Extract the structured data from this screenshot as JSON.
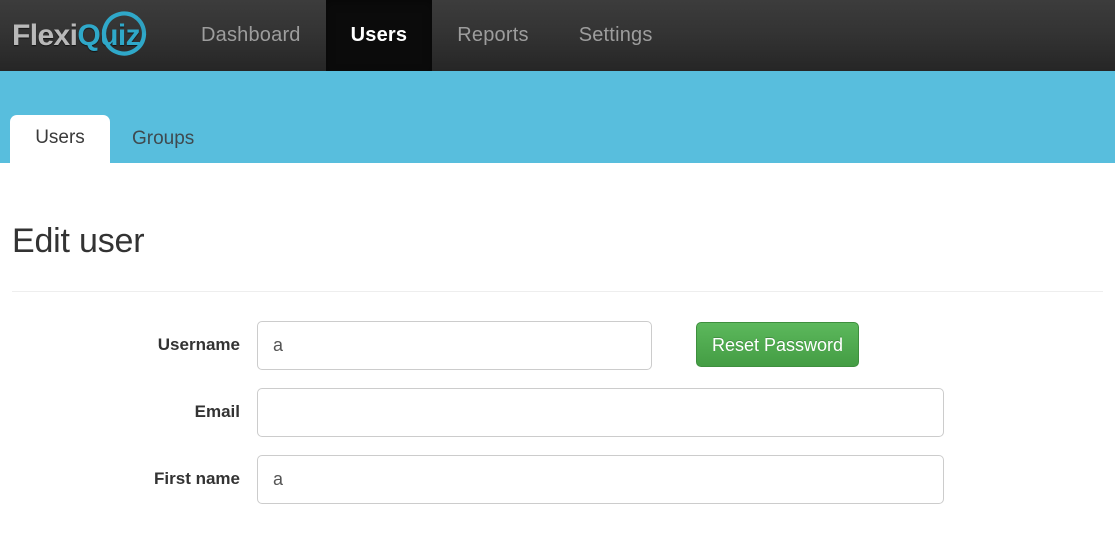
{
  "brand": {
    "name_part1": "Flexi",
    "name_part2": "Quiz",
    "ring_icon": "circular-arrow-ring-icon",
    "accent_color": "#2fa8c9",
    "text_color": "#b9b9b9"
  },
  "navbar": {
    "background_top": "#3c3c3c",
    "background_bottom": "#262626",
    "active_background": "#0b0b0b",
    "items": [
      {
        "label": "Dashboard",
        "active": false
      },
      {
        "label": "Users",
        "active": true
      },
      {
        "label": "Reports",
        "active": false
      },
      {
        "label": "Settings",
        "active": false
      }
    ]
  },
  "subnav": {
    "background_color": "#58bedd",
    "tabs": [
      {
        "label": "Users",
        "active": true
      },
      {
        "label": "Groups",
        "active": false
      }
    ]
  },
  "main": {
    "page_title": "Edit user",
    "form": {
      "rows": [
        {
          "label": "Username",
          "value": "a",
          "placeholder": "",
          "width": "narrow",
          "has_button": true
        },
        {
          "label": "Email",
          "value": "",
          "placeholder": "",
          "width": "wide",
          "has_button": false
        },
        {
          "label": "First name",
          "value": "a",
          "placeholder": "",
          "width": "wide",
          "has_button": false
        }
      ],
      "reset_password_label": "Reset Password",
      "reset_password_color": "#5cb85c"
    }
  }
}
